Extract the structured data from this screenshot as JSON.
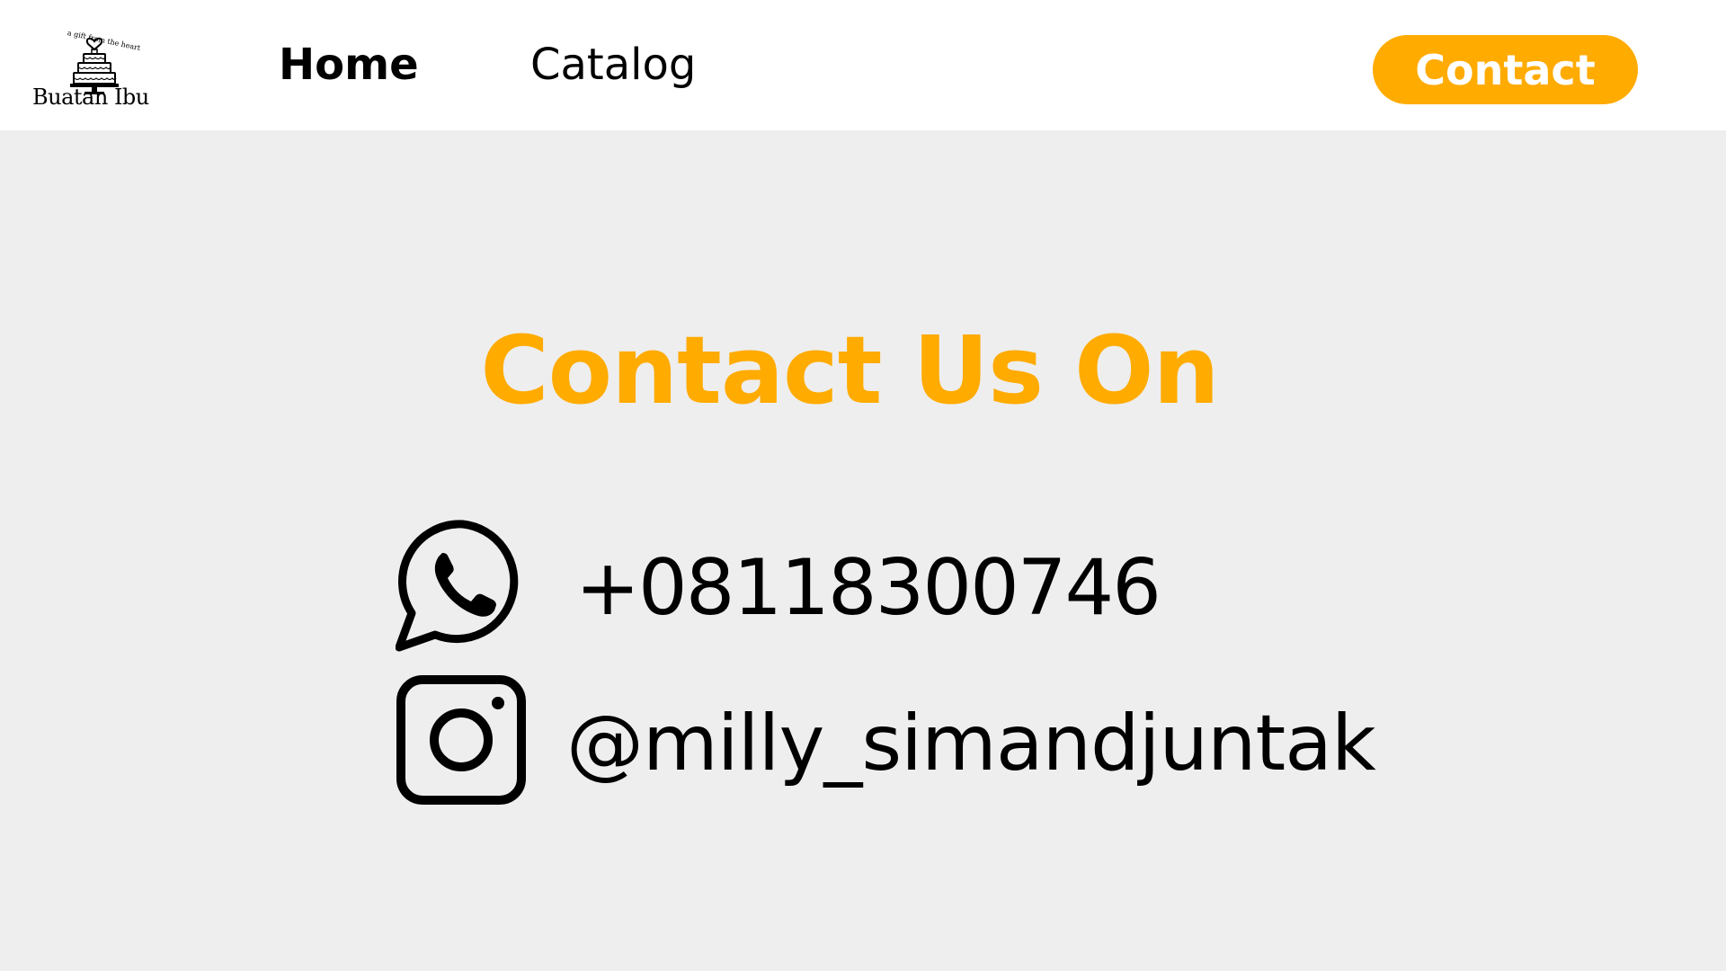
{
  "brand": {
    "name": "Buatan Ibu",
    "tagline": "a gift from the heart",
    "icon": "cake-icon"
  },
  "nav": {
    "home_label": "Home",
    "catalog_label": "Catalog",
    "contact_label": "Contact"
  },
  "contact": {
    "title": "Contact Us On",
    "whatsapp": {
      "icon": "whatsapp-icon",
      "value": "+08118300746"
    },
    "instagram": {
      "icon": "instagram-icon",
      "value": "@milly_simandjuntak"
    }
  },
  "colors": {
    "accent": "#ffab00",
    "header_bg": "#ffffff",
    "page_bg": "#eeeeee",
    "text": "#000000"
  }
}
